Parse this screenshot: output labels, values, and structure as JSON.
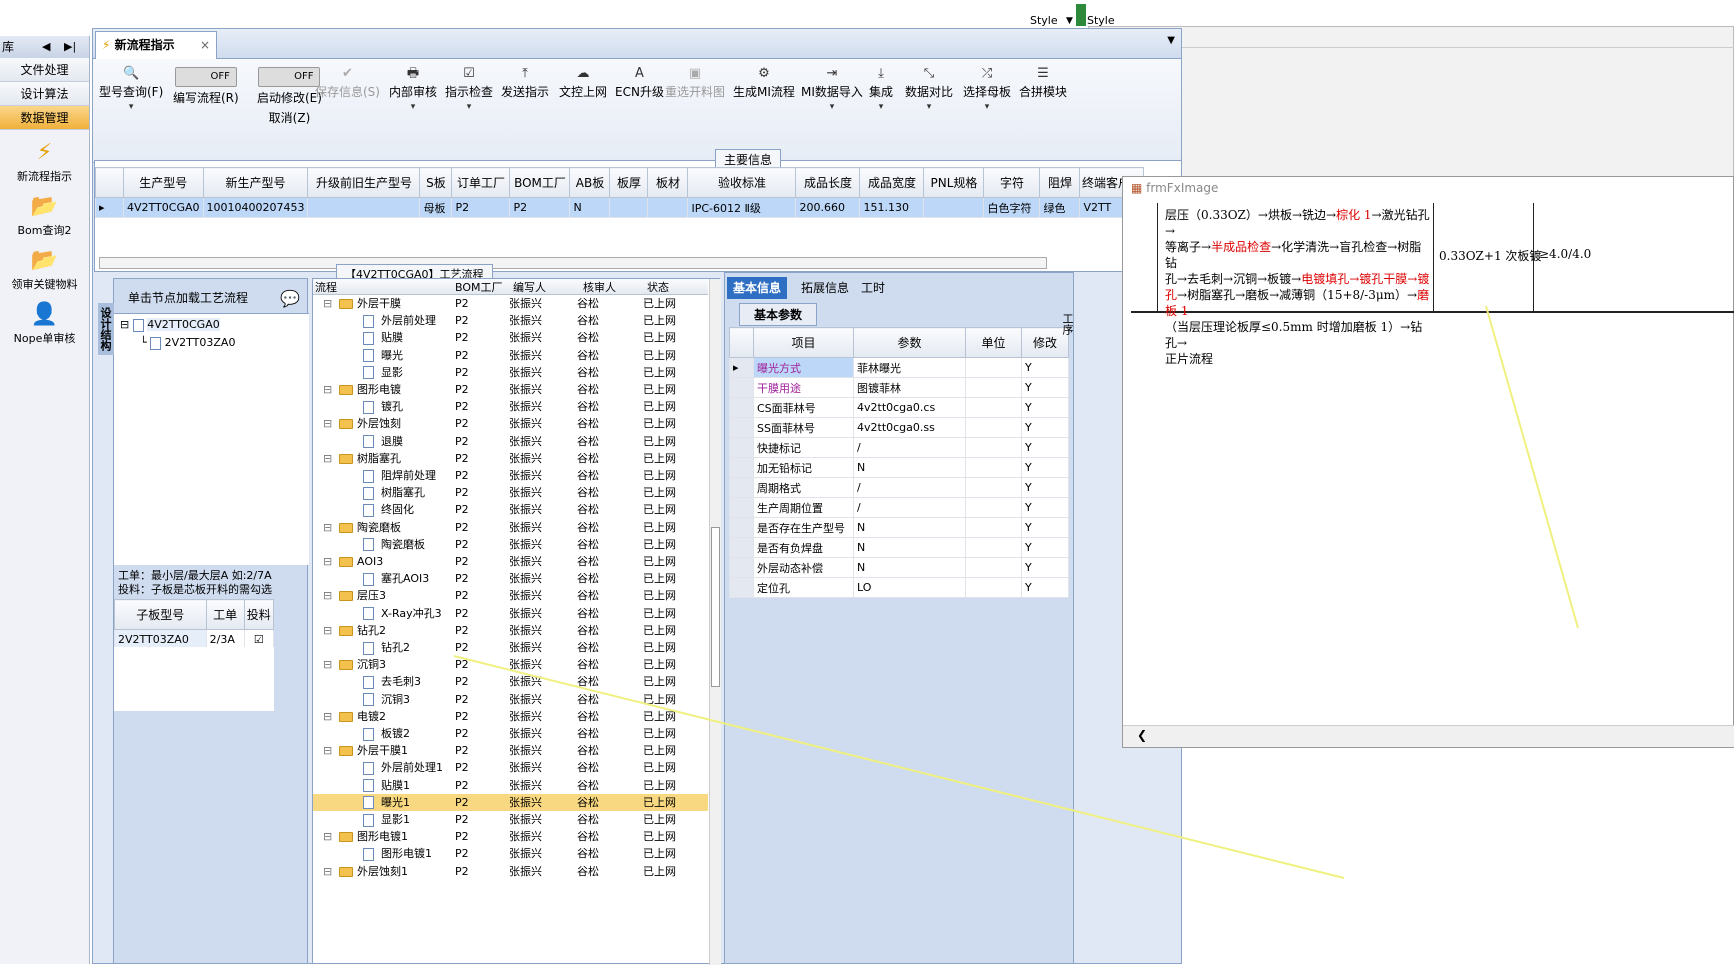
{
  "topbar": {
    "style_label": "Style"
  },
  "leftnav": {
    "header": "库",
    "items": [
      "文件处理",
      "设计算法",
      "数据管理"
    ],
    "icons": [
      {
        "label": "新流程指示",
        "icon": "lightning-icon"
      },
      {
        "label": "Bom查询2",
        "icon": "folder-icon"
      },
      {
        "label": "领审关键物料",
        "icon": "folder-icon"
      },
      {
        "label": "Nope单审核",
        "icon": "user-icon"
      }
    ]
  },
  "tab": {
    "title": "新流程指示",
    "close": "×"
  },
  "toolbar": {
    "items": [
      {
        "label": "型号查询(F)",
        "icon": "search-icon",
        "x": 0
      },
      {
        "label": "编写流程(R)",
        "x": 1
      },
      {
        "label": "启动修改(E)",
        "label2": "取消(Z)",
        "x": 2
      },
      {
        "label": "保存信息(S)",
        "x": 3,
        "disabled": true
      },
      {
        "label": "内部审核",
        "x": 4
      },
      {
        "label": "指示检查",
        "x": 5
      },
      {
        "label": "发送指示",
        "x": 6
      },
      {
        "label": "文控上网",
        "x": 7
      },
      {
        "label": "ECN升级",
        "x": 8
      },
      {
        "label": "重选开料图",
        "x": 9,
        "disabled": true
      },
      {
        "label": "生成MI流程",
        "x": 10
      },
      {
        "label": "MI数据导入",
        "x": 11
      },
      {
        "label": "集成",
        "x": 12
      },
      {
        "label": "数据对比",
        "x": 13
      },
      {
        "label": "选择母板",
        "x": 14
      },
      {
        "label": "合拼模块",
        "x": 15
      }
    ],
    "toggle_off": "OFF"
  },
  "info": {
    "title": "主要信息",
    "headers": [
      "生产型号",
      "新生产型号",
      "升级前旧生产型号",
      "S板",
      "订单工厂",
      "BOM工厂",
      "AB板",
      "板厚",
      "板材",
      "验收标准",
      "成品长度",
      "成品宽度",
      "PNL规格",
      "字符",
      "阻焊",
      "终端客户代"
    ],
    "row": [
      "4V2TT0CGA0",
      "10010400207453",
      "",
      "母板",
      "P2",
      "P2",
      "N",
      "",
      "",
      "IPC-6012 Ⅱ级",
      "200.660",
      "151.130",
      "",
      "白色字符",
      "绿色",
      "V2TT"
    ]
  },
  "tree": {
    "vertical_tab": "设计结构",
    "hint": "单击节点加载工艺流程",
    "root": "4V2TT0CGA0",
    "child": "2V2TT03ZA0",
    "note1": "工单：最小层/最大层A 如:2/7A",
    "note2": "投料：子板是芯板开料的需勾选",
    "sub_headers": [
      "子板型号",
      "工单",
      "投料"
    ],
    "sub_row": [
      "2V2TT03ZA0",
      "2/3A",
      ""
    ]
  },
  "flow": {
    "title": "【4V2TT0CGA0】工艺流程",
    "headers": [
      "流程",
      "BOM工厂",
      "编写人",
      "核审人",
      "状态"
    ],
    "factory": "P2",
    "writer": "张振兴",
    "reviewer": "谷松",
    "status": "已上网",
    "rows": [
      {
        "n": "外层干膜",
        "lv": 0
      },
      {
        "n": "外层前处理",
        "lv": 1
      },
      {
        "n": "贴膜",
        "lv": 1
      },
      {
        "n": "曝光",
        "lv": 1
      },
      {
        "n": "显影",
        "lv": 1
      },
      {
        "n": "图形电镀",
        "lv": 0
      },
      {
        "n": "镀孔",
        "lv": 1
      },
      {
        "n": "外层蚀刻",
        "lv": 0
      },
      {
        "n": "退膜",
        "lv": 1
      },
      {
        "n": "树脂塞孔",
        "lv": 0
      },
      {
        "n": "阻焊前处理",
        "lv": 1
      },
      {
        "n": "树脂塞孔",
        "lv": 1
      },
      {
        "n": "终固化",
        "lv": 1
      },
      {
        "n": "陶瓷磨板",
        "lv": 0
      },
      {
        "n": "陶瓷磨板",
        "lv": 1
      },
      {
        "n": "AOI3",
        "lv": 0
      },
      {
        "n": "塞孔AOI3",
        "lv": 1
      },
      {
        "n": "层压3",
        "lv": 0
      },
      {
        "n": "X-Ray冲孔3",
        "lv": 1
      },
      {
        "n": "钻孔2",
        "lv": 0
      },
      {
        "n": "钻孔2",
        "lv": 1
      },
      {
        "n": "沉铜3",
        "lv": 0
      },
      {
        "n": "去毛刺3",
        "lv": 1
      },
      {
        "n": "沉铜3",
        "lv": 1
      },
      {
        "n": "电镀2",
        "lv": 0
      },
      {
        "n": "板镀2",
        "lv": 1
      },
      {
        "n": "外层干膜1",
        "lv": 0
      },
      {
        "n": "外层前处理1",
        "lv": 1
      },
      {
        "n": "贴膜1",
        "lv": 1
      },
      {
        "n": "曝光1",
        "lv": 1,
        "hl": true
      },
      {
        "n": "显影1",
        "lv": 1
      },
      {
        "n": "图形电镀1",
        "lv": 0
      },
      {
        "n": "图形电镀1",
        "lv": 1
      },
      {
        "n": "外层蚀刻1",
        "lv": 0
      }
    ]
  },
  "right": {
    "tabs": [
      "基本信息",
      "拓展信息",
      "工时"
    ],
    "subtab": "基本参数",
    "side_tab": "工序",
    "headers": [
      "项目",
      "参数",
      "单位",
      "修改"
    ],
    "rows": [
      {
        "k": "曝光方式",
        "v": "菲林曝光",
        "m": "Y",
        "c": "#a0209a"
      },
      {
        "k": "干膜用途",
        "v": "图镀菲林",
        "m": "Y",
        "c": "#a0209a"
      },
      {
        "k": "CS面菲林号",
        "v": "4v2tt0cga0.cs",
        "m": "Y"
      },
      {
        "k": "SS面菲林号",
        "v": "4v2tt0cga0.ss",
        "m": "Y"
      },
      {
        "k": "快捷标记",
        "v": "/",
        "m": "Y"
      },
      {
        "k": "加无铅标记",
        "v": "N",
        "m": "Y"
      },
      {
        "k": "周期格式",
        "v": "/",
        "m": "Y"
      },
      {
        "k": "生产周期位置",
        "v": "/",
        "m": "Y"
      },
      {
        "k": "是否存在生产型号",
        "v": "N",
        "m": "Y"
      },
      {
        "k": "是否有负焊盘",
        "v": "N",
        "m": "Y"
      },
      {
        "k": "外层动态补偿",
        "v": "N",
        "m": "Y"
      },
      {
        "k": "定位孔",
        "v": "LO",
        "m": "Y"
      }
    ]
  },
  "imgwin": {
    "title": "frmFxImage",
    "line1": "层压（0.33OZ）→烘板→铣边→",
    "line1r": "棕化 1",
    "line1b": "→激光钻孔→",
    "line2a": "等离子→",
    "line2r": "半成品检查",
    "line2b": "→化学清洗→盲孔检查→树脂钻",
    "line3a": "孔→去毛刺→沉铜→板镀→",
    "line3r": "电镀填孔→镀孔干膜→镀",
    "line4a": "孔",
    "line4b": "→树脂塞孔→磨板→减薄铜（15+8/-3μm）→",
    "line4r": "磨板 1",
    "line5": "（当层压理论板厚≤0.5mm 时增加磨板 1）→钻孔→",
    "line6": "正片流程",
    "col2": "0.33OZ+1 次板镀",
    "col3": "≥4.0/4.0"
  }
}
